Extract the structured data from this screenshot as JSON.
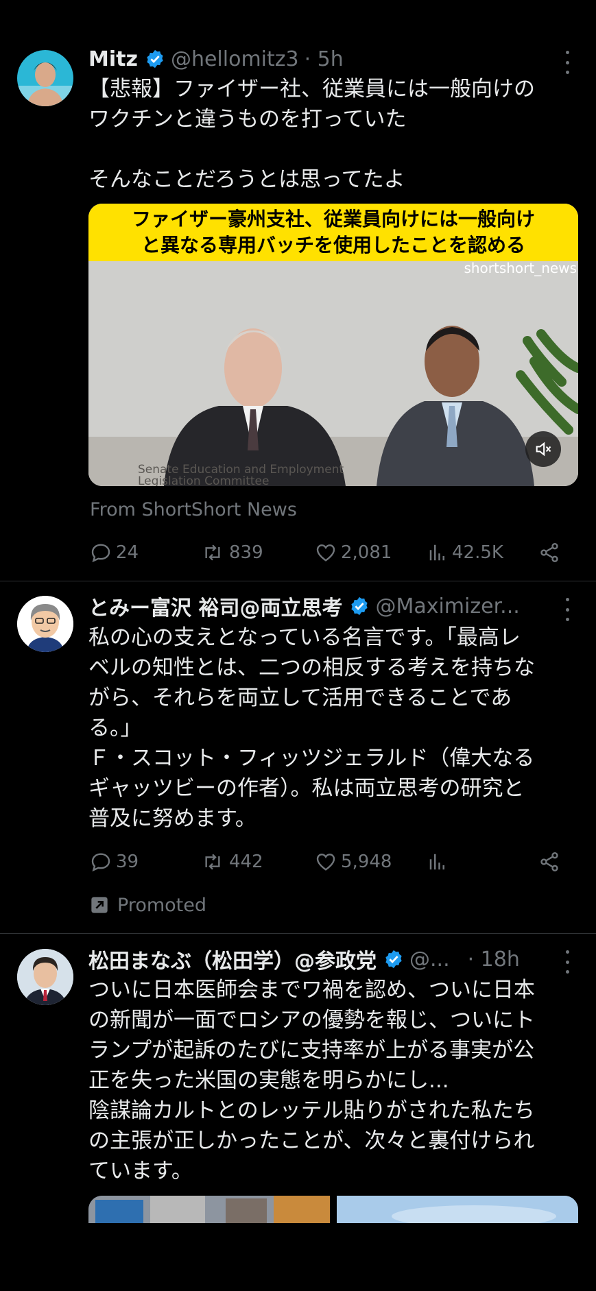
{
  "tweets": [
    {
      "name": "Mitz",
      "handle": "@hellomitz3",
      "time": "· 5h",
      "text_lines": [
        "【悲報】ファイザー社、従業員には一般向けの",
        "ワクチンと違うものを打っていた",
        "",
        "そんなことだろうとは思ってたよ"
      ],
      "video": {
        "caption_line1": "ファイザー豪州支社、従業員向けには一般向け",
        "caption_line2": "と異なる専用バッチを使用したことを認める",
        "watermark": "shortshort_news",
        "lower_third_1": "Senate Education and Employment",
        "lower_third_2": "Legislation Committee"
      },
      "source": "From ShortShort News",
      "replies": "24",
      "retweets": "839",
      "likes": "2,081",
      "views": "42.5K"
    },
    {
      "name": "とみー富沢 裕司@両立思考",
      "handle": "@Maximizer...",
      "text_lines": [
        "私の心の支えとなっている名言です。「最高レ",
        "ベルの知性とは、二つの相反する考えを持ちな",
        "がら、それらを両立して活用できることであ",
        "る。」",
        "Ｆ・スコット・フィッツジェラルド（偉大なる",
        "ギャッツビーの作者）。私は両立思考の研究と",
        "普及に努めます。"
      ],
      "replies": "39",
      "retweets": "442",
      "likes": "5,948",
      "promoted": "Promoted"
    },
    {
      "name": "松田まなぶ（松田学）@参政党",
      "handle": "@...",
      "time": "· 18h",
      "text_lines": [
        "ついに日本医師会までワ禍を認め、ついに日本",
        "の新聞が一面でロシアの優勢を報じ、ついにト",
        "ランプが起訴のたびに支持率が上がる事実が公",
        "正を失った米国の実態を明らかにし...",
        "陰謀論カルトとのレッテル貼りがされた私たち",
        "の主張が正しかったことが、次々と裏付けられ",
        "ています。"
      ]
    }
  ],
  "colors": {
    "verified": "#1d9bf0",
    "muted": "#71767b",
    "text": "#e7e9ea",
    "caption_bg": "#ffe100"
  }
}
